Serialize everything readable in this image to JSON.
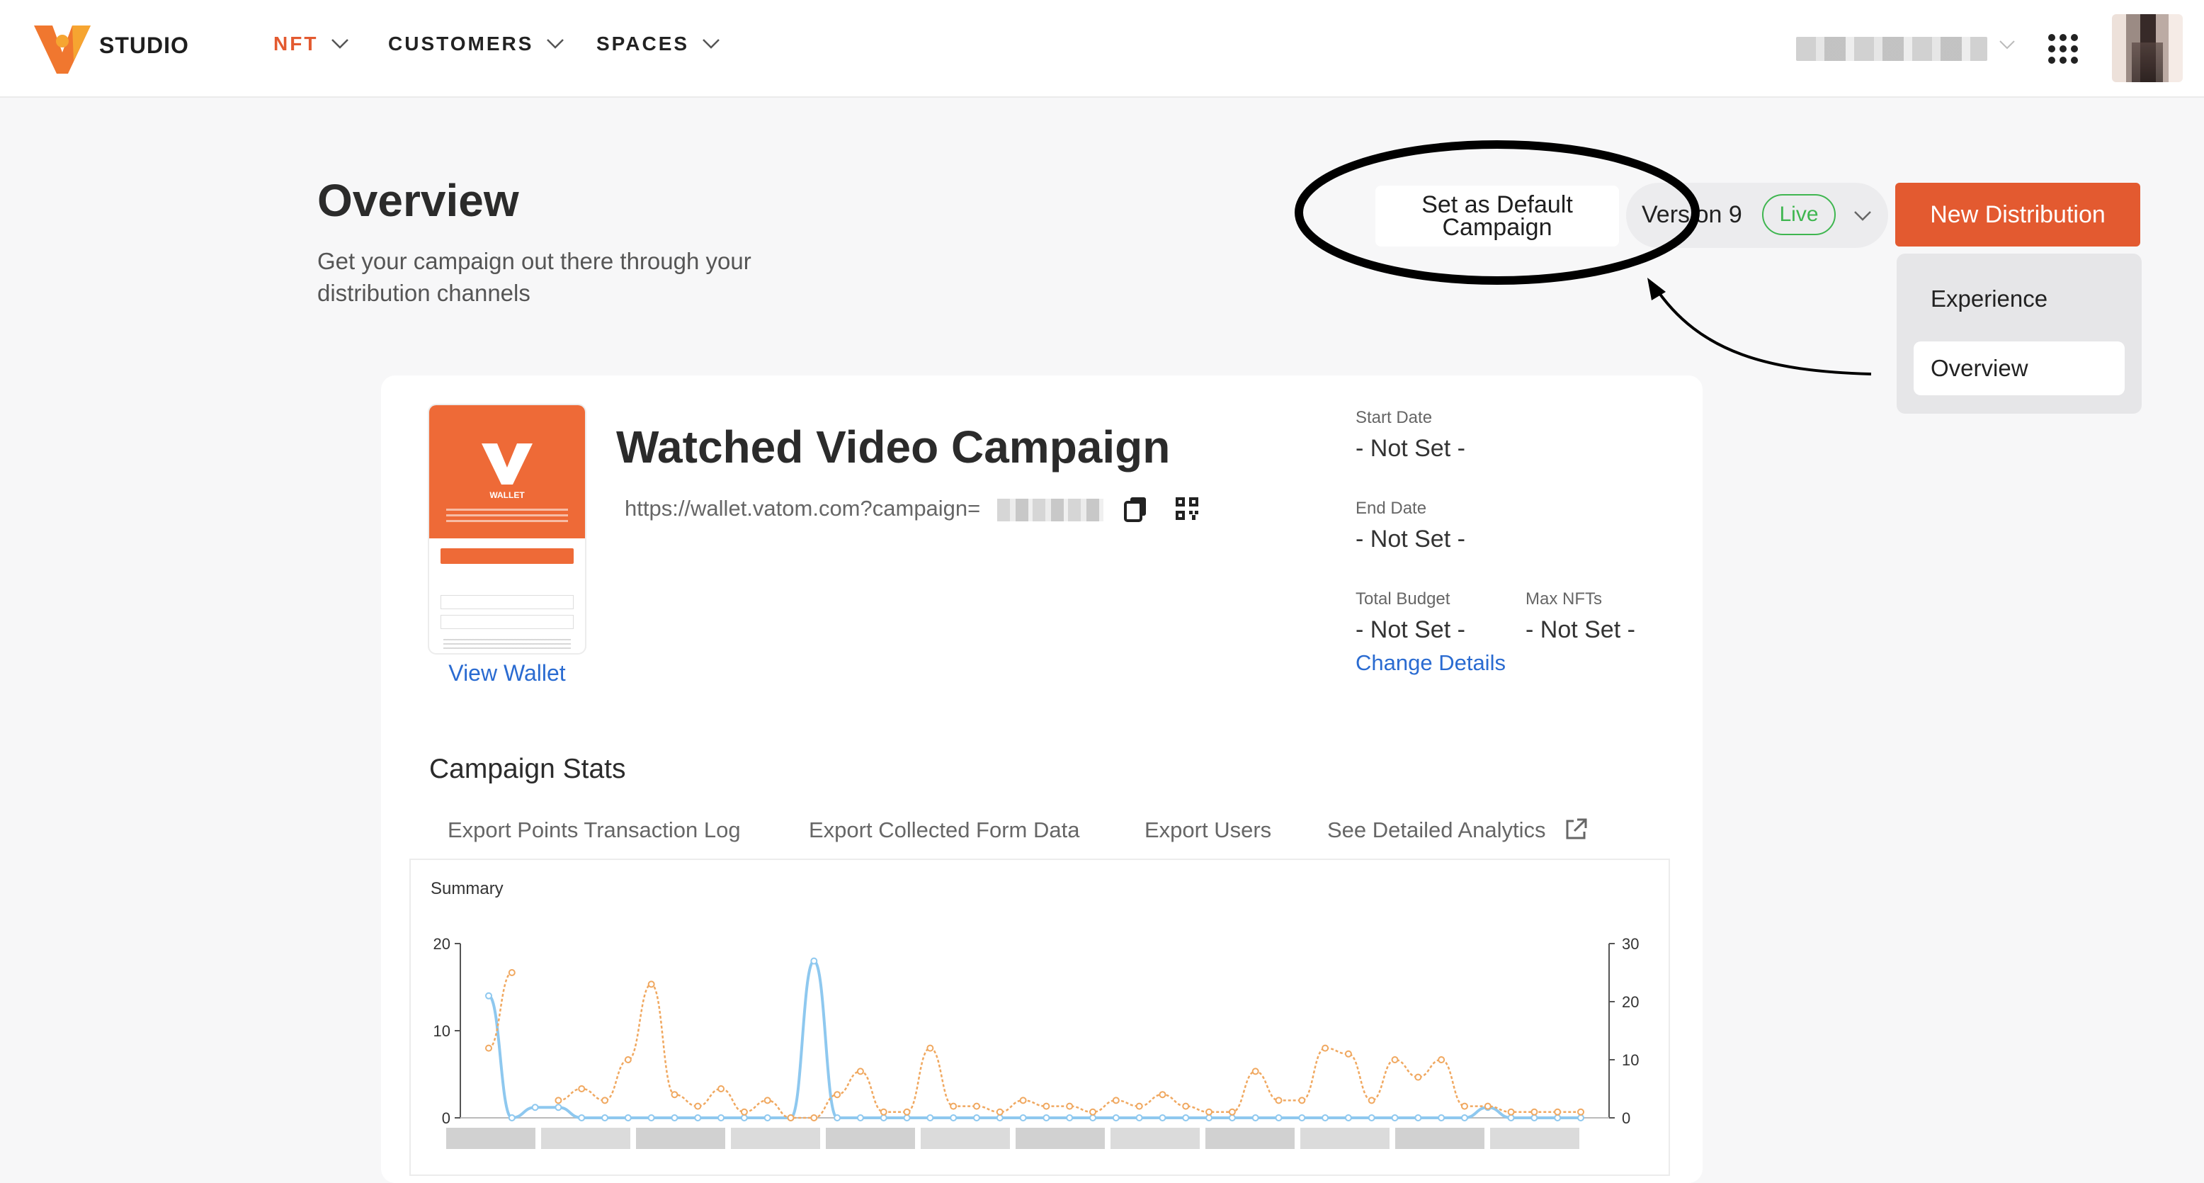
{
  "app": {
    "brand": "STUDIO"
  },
  "nav": {
    "items": [
      {
        "label": "NFT",
        "active": true
      },
      {
        "label": "CUSTOMERS",
        "active": false
      },
      {
        "label": "SPACES",
        "active": false
      }
    ]
  },
  "header": {
    "title": "Overview",
    "subtitle": "Get your campaign out there through your distribution channels",
    "set_default_label": "Set as Default Campaign",
    "version_label": "Version 9",
    "live_badge": "Live",
    "new_distribution_label": "New Distribution",
    "menu_items": [
      "Experience",
      "Overview"
    ],
    "menu_selected": "Overview"
  },
  "campaign": {
    "name": "Watched Video Campaign",
    "url": "https://wallet.vatom.com?campaign=",
    "view_wallet_label": "View Wallet",
    "wallet_brand": "WALLET",
    "start_date_label": "Start Date",
    "start_date_value": "- Not Set -",
    "end_date_label": "End Date",
    "end_date_value": "- Not Set -",
    "total_budget_label": "Total Budget",
    "total_budget_value": "- Not Set -",
    "max_nfts_label": "Max NFTs",
    "max_nfts_value": "- Not Set -",
    "change_details_label": "Change Details"
  },
  "stats": {
    "title": "Campaign Stats",
    "exports": [
      "Export Points Transaction Log",
      "Export Collected Form Data",
      "Export Users",
      "See Detailed Analytics"
    ]
  },
  "colors": {
    "accent": "#e35a30",
    "link": "#2a6bd1",
    "live": "#3fb650",
    "series_blue": "#8ec8ef",
    "series_orange": "#f0a860"
  },
  "icons": {
    "grid": "apps-grid-icon",
    "copy": "copy-icon",
    "qr": "qr-code-icon",
    "external": "external-link-icon",
    "chevron": "chevron-down-icon"
  },
  "chart_data": {
    "type": "line",
    "title": "Summary",
    "ylim_left": [
      0,
      20
    ],
    "ylim_right": [
      0,
      30
    ],
    "yticks_left": [
      "20",
      "10",
      "0"
    ],
    "yticks_right": [
      "30",
      "20",
      "10",
      "0"
    ],
    "grid": false,
    "series": [
      {
        "axis": "left",
        "color": "#8ec8ef",
        "values": [
          14,
          0,
          1.2,
          1.2,
          0,
          0,
          0,
          0,
          0,
          0,
          0,
          0,
          0,
          0,
          18,
          0,
          0,
          0,
          0,
          0,
          0,
          0,
          0,
          0,
          0,
          0,
          0,
          0,
          0,
          0,
          0,
          0,
          0,
          0,
          0,
          0,
          0,
          0,
          0,
          0,
          0,
          0,
          0,
          1.2,
          0,
          0,
          0,
          0
        ]
      },
      {
        "axis": "right",
        "color": "#f0a860",
        "values": [
          12,
          25,
          null,
          3,
          5,
          3,
          10,
          23,
          4,
          2,
          5,
          1,
          3,
          0,
          0,
          4,
          8,
          1,
          1,
          12,
          2,
          2,
          1,
          3,
          2,
          2,
          1,
          3,
          2,
          4,
          2,
          1,
          1,
          8,
          3,
          3,
          12,
          11,
          3,
          10,
          7,
          10,
          2,
          2,
          1,
          1,
          1,
          1
        ]
      }
    ]
  }
}
